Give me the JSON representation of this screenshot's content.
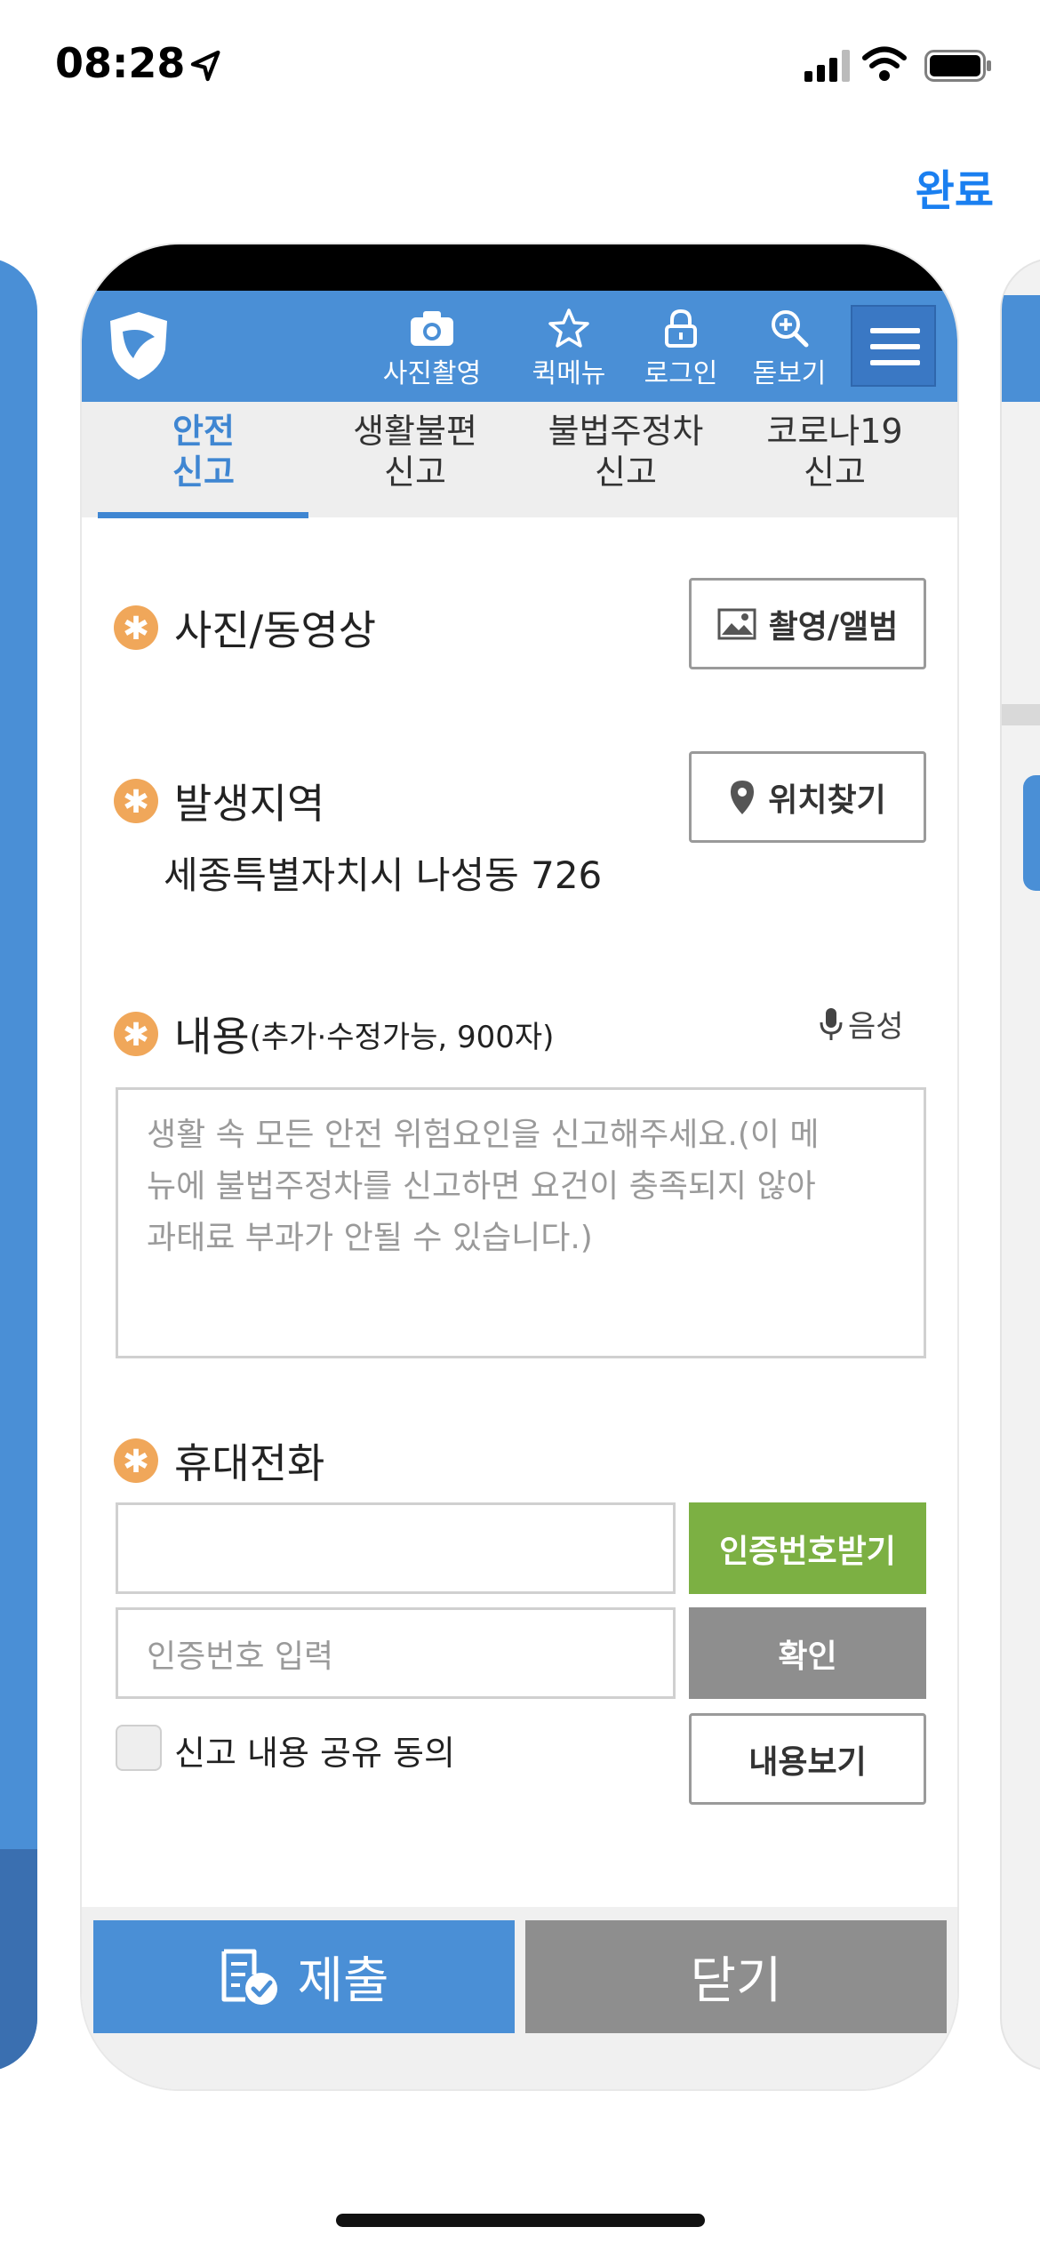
{
  "status_bar": {
    "time": "08:28"
  },
  "done_label": "완료",
  "header": {
    "buttons": [
      {
        "label": "사진촬영",
        "icon": "camera-icon"
      },
      {
        "label": "퀵메뉴",
        "icon": "star-icon"
      },
      {
        "label": "로그인",
        "icon": "lock-icon"
      },
      {
        "label": "돋보기",
        "icon": "zoom-icon"
      }
    ]
  },
  "tabs": [
    {
      "line1": "안전",
      "line2": "신고",
      "active": true
    },
    {
      "line1": "생활불편",
      "line2": "신고"
    },
    {
      "line1": "불법주정차",
      "line2": "신고"
    },
    {
      "line1": "코로나19",
      "line2": "신고"
    }
  ],
  "form": {
    "photo": {
      "label": "사진/동영상",
      "button": "촬영/앨범"
    },
    "location": {
      "label": "발생지역",
      "button": "위치찾기",
      "address": "세종특별자치시 나성동 726"
    },
    "content": {
      "label": "내용",
      "note": "(추가·수정가능, 900자)",
      "voice": "음성",
      "placeholder_lines": [
        "생활 속 모든 안전 위험요인을 신고해주세요.(이 메",
        "뉴에 불법주정차를 신고하면 요건이 충족되지 않아",
        "과태료 부과가 안될 수 있습니다.)"
      ]
    },
    "phone": {
      "label": "휴대전화",
      "value": "",
      "verify_button": "인증번호받기",
      "code_placeholder": "인증번호 입력",
      "confirm_button": "확인"
    },
    "consent": {
      "label": "신고 내용 공유 동의",
      "button": "내용보기"
    }
  },
  "footer": {
    "submit": "제출",
    "close": "닫기"
  },
  "colors": {
    "primary": "#4a8fd6",
    "green": "#7cb043",
    "gray": "#8e8e8e",
    "accent_star": "#f0a75a",
    "ios_blue": "#1a7ff0"
  }
}
